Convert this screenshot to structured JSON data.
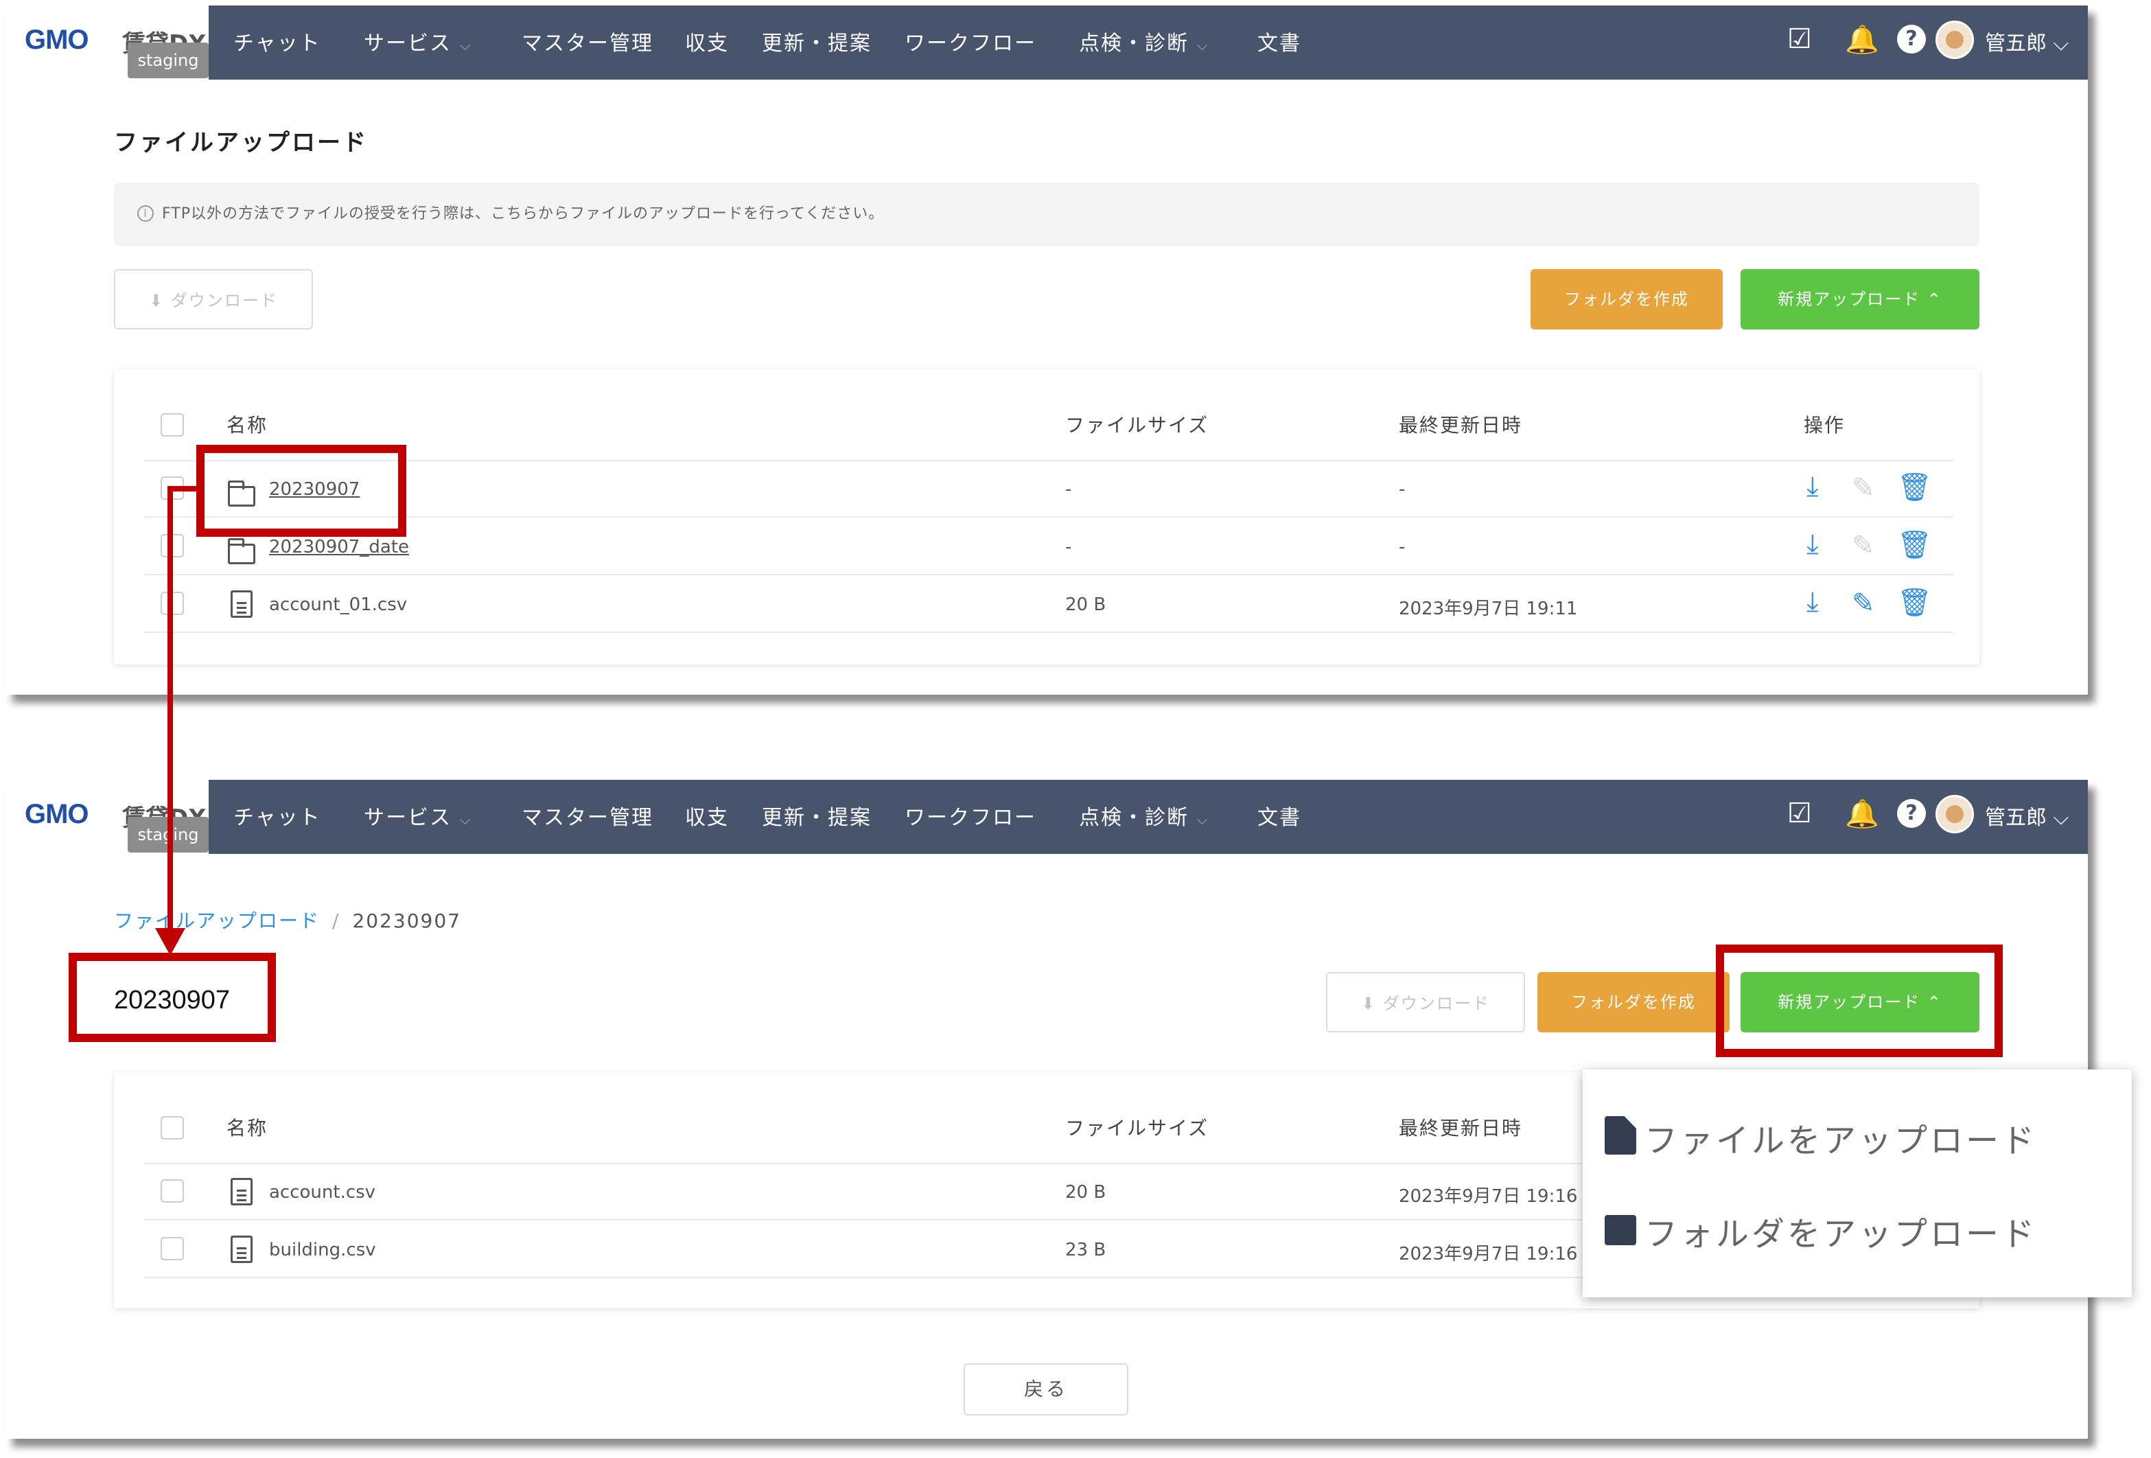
{
  "app": {
    "logo": "GMO",
    "logo_sub": "賃貸DX",
    "env_badge": "staging",
    "nav": [
      {
        "label": "チャット",
        "has_dropdown": false
      },
      {
        "label": "サービス",
        "has_dropdown": true
      },
      {
        "label": "マスター管理",
        "has_dropdown": false
      },
      {
        "label": "収支",
        "has_dropdown": false
      },
      {
        "label": "更新・提案",
        "has_dropdown": false
      },
      {
        "label": "ワークフロー",
        "has_dropdown": false
      },
      {
        "label": "点検・診断",
        "has_dropdown": true
      },
      {
        "label": "文書",
        "has_dropdown": false
      }
    ],
    "help_glyph": "?",
    "user_name": "管五郎",
    "nav_bg": "#48546c"
  },
  "screen1": {
    "title": "ファイルアップロード",
    "info": "FTP以外の方法でファイルの授受を行う際は、こちらからファイルのアップロードを行ってください。",
    "info_glyph": "i",
    "download_label": "ダウンロード",
    "create_folder_label": "フォルダを作成",
    "new_upload_label": "新規アップロード",
    "columns": {
      "name": "名称",
      "size": "ファイルサイズ",
      "updated": "最終更新日時",
      "actions": "操作"
    },
    "rows": [
      {
        "type": "folder",
        "name": "20230907",
        "size": "-",
        "updated": "-",
        "editable": false
      },
      {
        "type": "folder",
        "name": "20230907_date",
        "size": "-",
        "updated": "-",
        "editable": false
      },
      {
        "type": "file",
        "name": "account_01.csv",
        "size": "20 B",
        "updated": "2023年9月7日 19:11",
        "editable": true
      }
    ]
  },
  "screen2": {
    "breadcrumb": {
      "parent": "ファイルアップロード",
      "separator": "/",
      "current": "20230907"
    },
    "folder_title": "20230907",
    "download_label": "ダウンロード",
    "create_folder_label": "フォルダを作成",
    "new_upload_label": "新規アップロード",
    "columns": {
      "name": "名称",
      "size": "ファイルサイズ",
      "updated": "最終更新日時"
    },
    "rows": [
      {
        "type": "file",
        "name": "account.csv",
        "size": "20 B",
        "updated": "2023年9月7日 19:16"
      },
      {
        "type": "file",
        "name": "building.csv",
        "size": "23 B",
        "updated": "2023年9月7日 19:16"
      }
    ],
    "upload_menu": [
      {
        "label": "ファイルをアップロード",
        "icon": "file-icon"
      },
      {
        "label": "フォルダをアップロード",
        "icon": "folder-icon"
      }
    ],
    "back_label": "戻る"
  },
  "colors": {
    "highlight": "#c00000",
    "green": "#5cc543",
    "orange": "#e8a33a",
    "link": "#2f8fe8"
  }
}
